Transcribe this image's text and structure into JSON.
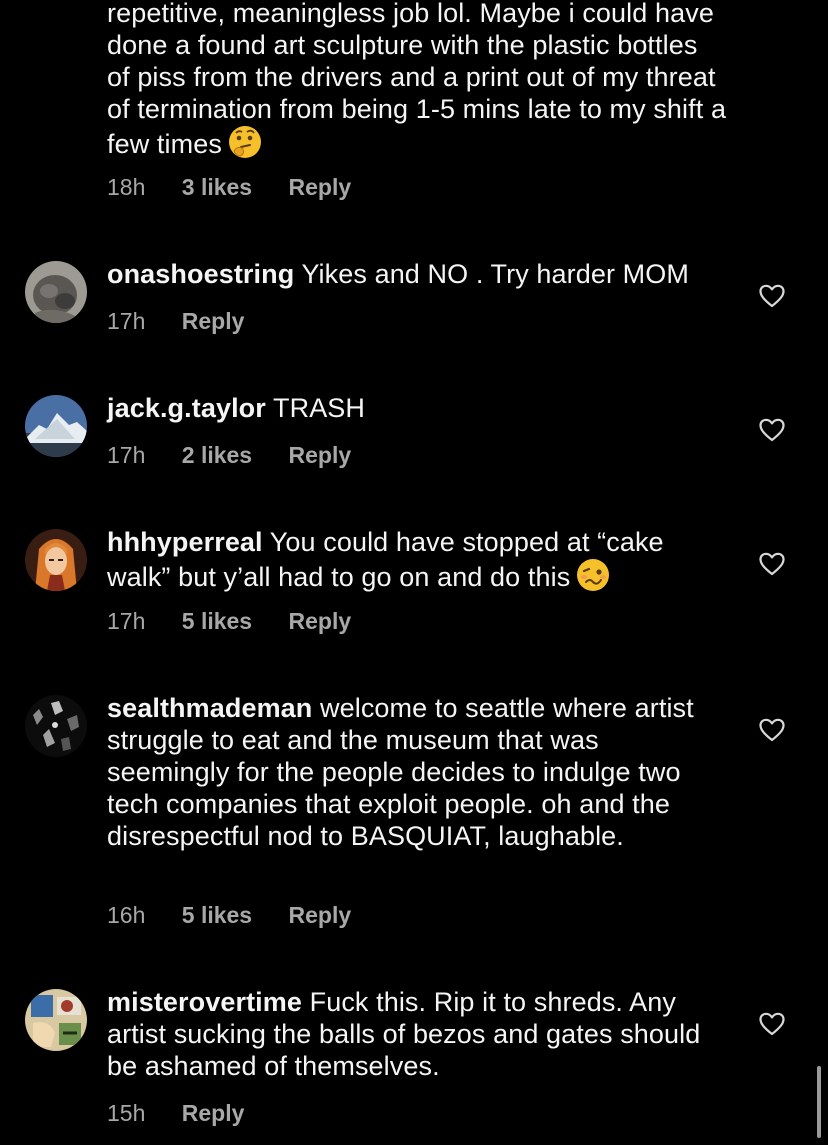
{
  "top_comment": {
    "text": "repetitive, meaningless job lol. Maybe i could have done a found art sculpture with the plastic bottles of piss from the drivers and a print out of my threat of termination from being 1-5 mins late to my shift a few times",
    "emoji": "thinking-face-emoji",
    "time": "18h",
    "likes": "3 likes",
    "reply": "Reply"
  },
  "comments": [
    {
      "username": "onashoestring",
      "text": "Yikes and NO . Try harder MOM",
      "time": "17h",
      "likes": "",
      "reply": "Reply",
      "avatar_icon": "cat-avatar"
    },
    {
      "username": "jack.g.taylor",
      "text": "TRASH",
      "time": "17h",
      "likes": "2 likes",
      "reply": "Reply",
      "avatar_icon": "mountain-avatar"
    },
    {
      "username": "hhhyperreal",
      "text": "You could have stopped at “cake walk” but y’all had to go on and do this",
      "emoji": "woozy-face-emoji",
      "time": "17h",
      "likes": "5 likes",
      "reply": "Reply",
      "avatar_icon": "anime-girl-avatar"
    },
    {
      "username": "sealthmademan",
      "text": "welcome to seattle where artist struggle to eat and the museum that was seemingly for the people decides to indulge two tech companies that exploit people. oh and the disrespectful nod to BASQUIAT, laughable.",
      "time": "16h",
      "likes": "5 likes",
      "reply": "Reply",
      "avatar_icon": "dark-photo-avatar"
    },
    {
      "username": "misterovertime",
      "text": "Fuck this. Rip it to shreds. Any artist sucking the balls of bezos and gates should be ashamed of themselves.",
      "time": "15h",
      "likes": "",
      "reply": "Reply",
      "avatar_icon": "cartoon-avatar"
    }
  ],
  "colors": {
    "background": "#000000",
    "text": "#f5f5f5",
    "meta": "#a8a8a8"
  }
}
